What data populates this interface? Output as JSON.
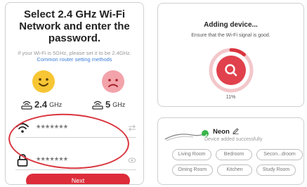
{
  "wifi_setup": {
    "title": "Select 2.4 GHz Wi-Fi Network and enter the password.",
    "description": "If your Wi-Fi is 5GHz, please set it to be 2.4GHz.",
    "link_text": "Common router setting methods",
    "bands": [
      {
        "label": "2.4",
        "unit": "GHz",
        "face": "happy"
      },
      {
        "label": "5",
        "unit": "GHz",
        "face": "sad"
      }
    ],
    "network_value": "*******",
    "password_value": "*******",
    "next_label": "Next"
  },
  "adding": {
    "title": "Adding device...",
    "subtitle": "Ensure that the Wi-Fi signal is good.",
    "progress_percent": 11,
    "progress_text": "11%",
    "accent_color": "#d9353f"
  },
  "device": {
    "name": "Neon",
    "status": "Device added successfully",
    "rooms": [
      "Living Room",
      "Bedroom",
      "Secon...droom",
      "Dining Room",
      "Kitchen",
      "Study Room"
    ]
  }
}
